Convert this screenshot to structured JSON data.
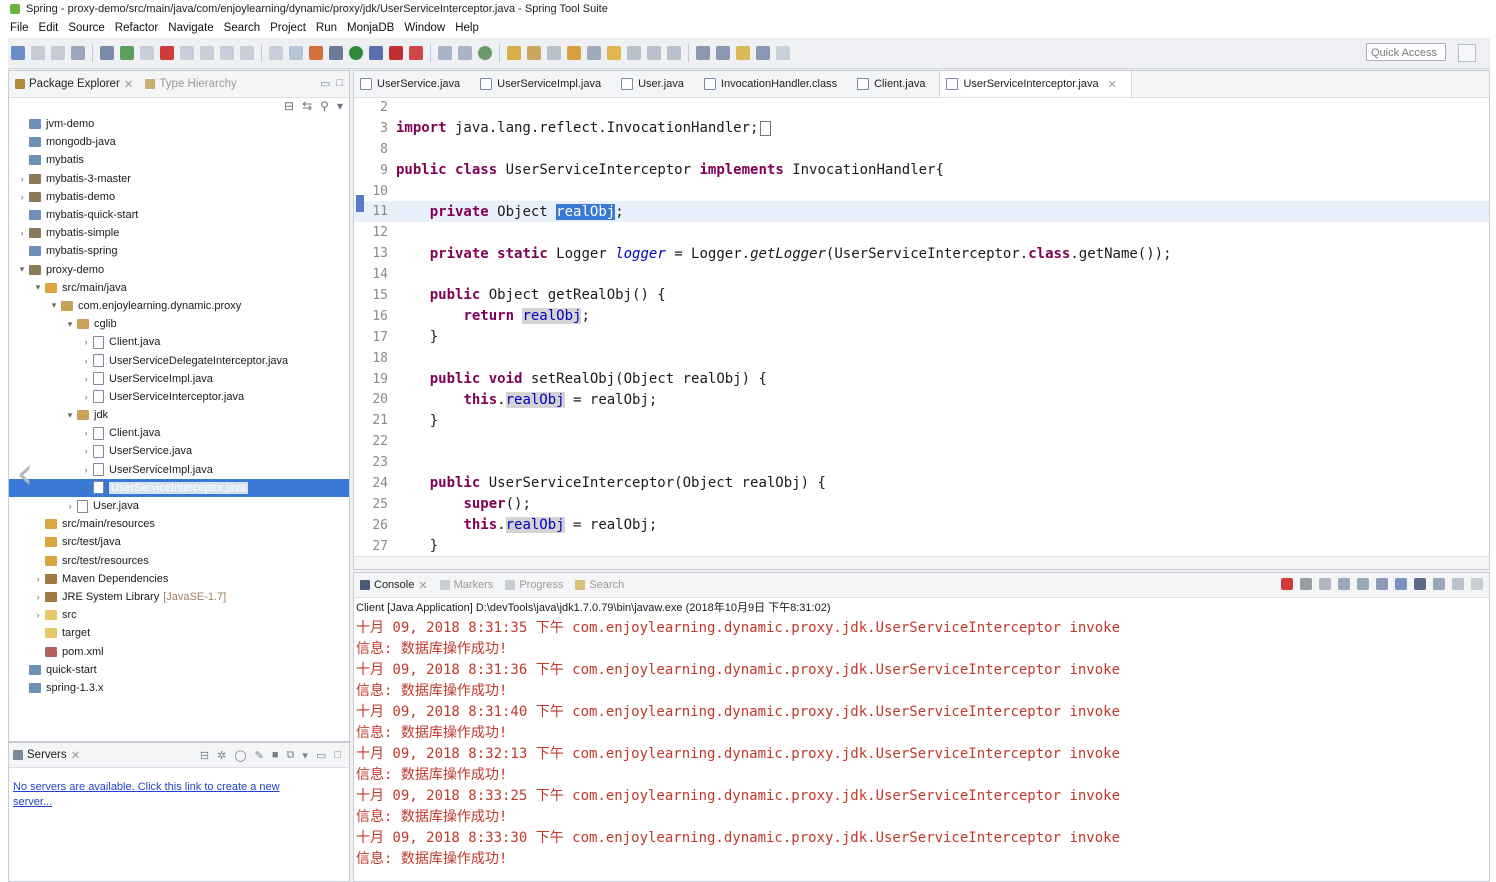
{
  "window": {
    "title": "Spring - proxy-demo/src/main/java/com/enjoylearning/dynamic/proxy/jdk/UserServiceInterceptor.java - Spring Tool Suite"
  },
  "menu": [
    "File",
    "Edit",
    "Source",
    "Refactor",
    "Navigate",
    "Search",
    "Project",
    "Run",
    "MonjaDB",
    "Window",
    "Help"
  ],
  "toolbar": {
    "quick_access": "Quick Access"
  },
  "explorer": {
    "tab_label": "Package Explorer",
    "tab2_label": "Type Hierarchy",
    "tree": [
      {
        "label": "jvm-demo",
        "arrow": "",
        "icon": "project",
        "indent": 0
      },
      {
        "label": "mongodb-java",
        "arrow": "",
        "icon": "project",
        "indent": 0
      },
      {
        "label": "mybatis",
        "arrow": "",
        "icon": "project",
        "indent": 0
      },
      {
        "label": "mybatis-3-master",
        "arrow": ">",
        "icon": "maven",
        "indent": 0
      },
      {
        "label": "mybatis-demo",
        "arrow": ">",
        "icon": "maven",
        "indent": 0
      },
      {
        "label": "mybatis-quick-start",
        "arrow": "",
        "icon": "project",
        "indent": 0
      },
      {
        "label": "mybatis-simple",
        "arrow": ">",
        "icon": "maven",
        "indent": 0
      },
      {
        "label": "mybatis-spring",
        "arrow": "",
        "icon": "project",
        "indent": 0
      },
      {
        "label": "proxy-demo",
        "arrow": "v",
        "icon": "maven",
        "indent": 0
      },
      {
        "label": "src/main/java",
        "arrow": "v",
        "icon": "srcf",
        "indent": 1
      },
      {
        "label": "com.enjoylearning.dynamic.proxy",
        "arrow": "v",
        "icon": "pkg",
        "indent": 2
      },
      {
        "label": "cglib",
        "arrow": "v",
        "icon": "pkg",
        "indent": 3
      },
      {
        "label": "Client.java",
        "arrow": ">",
        "icon": "java",
        "indent": 4
      },
      {
        "label": "UserServiceDelegateInterceptor.java",
        "arrow": ">",
        "icon": "java",
        "indent": 4
      },
      {
        "label": "UserServiceImpl.java",
        "arrow": ">",
        "icon": "java",
        "indent": 4
      },
      {
        "label": "UserServiceInterceptor.java",
        "arrow": ">",
        "icon": "java",
        "indent": 4
      },
      {
        "label": "jdk",
        "arrow": "v",
        "icon": "pkg",
        "indent": 3
      },
      {
        "label": "Client.java",
        "arrow": ">",
        "icon": "java",
        "indent": 4
      },
      {
        "label": "UserService.java",
        "arrow": ">",
        "icon": "java",
        "indent": 4
      },
      {
        "label": "UserServiceImpl.java",
        "arrow": ">",
        "icon": "java",
        "indent": 4
      },
      {
        "label": "UserServiceInterceptor.java",
        "arrow": ">",
        "icon": "java",
        "indent": 4,
        "selected": true
      },
      {
        "label": "User.java",
        "arrow": ">",
        "icon": "java",
        "indent": 3
      },
      {
        "label": "src/main/resources",
        "arrow": "",
        "icon": "srcf",
        "indent": 1
      },
      {
        "label": "src/test/java",
        "arrow": "",
        "icon": "srcf",
        "indent": 1
      },
      {
        "label": "src/test/resources",
        "arrow": "",
        "icon": "srcf",
        "indent": 1
      },
      {
        "label": "Maven Dependencies",
        "arrow": ">",
        "icon": "lib",
        "indent": 1
      },
      {
        "label": "JRE System Library",
        "suffix": "[JavaSE-1.7]",
        "arrow": ">",
        "icon": "lib",
        "indent": 1
      },
      {
        "label": "src",
        "arrow": ">",
        "icon": "folder",
        "indent": 1
      },
      {
        "label": "target",
        "arrow": "",
        "icon": "folder",
        "indent": 1
      },
      {
        "label": "pom.xml",
        "arrow": "",
        "icon": "xml",
        "indent": 1
      },
      {
        "label": "quick-start",
        "arrow": "",
        "icon": "project",
        "indent": 0
      },
      {
        "label": "spring-1.3.x",
        "arrow": "",
        "icon": "project",
        "indent": 0
      }
    ]
  },
  "servers": {
    "tab_label": "Servers",
    "link": "No servers are available. Click this link to create a new server..."
  },
  "editor": {
    "tabs": [
      "UserService.java",
      "UserServiceImpl.java",
      "User.java",
      "InvocationHandler.class",
      "Client.java",
      "UserServiceInterceptor.java"
    ],
    "active_tab": 5,
    "line_numbers": [
      "2",
      "3",
      "8",
      "9",
      "10",
      "11",
      "12",
      "13",
      "14",
      "15",
      "16",
      "17",
      "18",
      "19",
      "20",
      "21",
      "22",
      "23",
      "24",
      "25",
      "26",
      "27"
    ],
    "code": {
      "l3_import": "import",
      "l3_rest": " java.lang.reflect.InvocationHandler;",
      "l9_public": "public",
      "l9_class": "class",
      "l9_name": " UserServiceInterceptor ",
      "l9_impl": "implements",
      "l9_rest": " InvocationHandler{",
      "l11_private": "private",
      "l11_type": " Object ",
      "l11_field": "realObj",
      "l11_semi": ";",
      "l13_private": "private",
      "l13_static": "static",
      "l13_type": " Logger ",
      "l13_field": "logger",
      "l13_eq": " = Logger.",
      "l13_method": "getLogger",
      "l13_arg": "(UserServiceInterceptor.",
      "l13_classkw": "class",
      "l13_rest": ".getName());",
      "l15_public": "public",
      "l15_rest": " Object getRealObj() {",
      "l16_return": "return",
      "l16_field": "realObj",
      "l16_semi": ";",
      "l17": "}",
      "l19_public": "public",
      "l19_void": "void",
      "l19_rest": " setRealObj(Object realObj) {",
      "l20_this": "this",
      "l20_dot": ".",
      "l20_field": "realObj",
      "l20_rest": " = realObj;",
      "l21": "}",
      "l24_public": "public",
      "l24_rest": " UserServiceInterceptor(Object realObj) {",
      "l25_super": "super",
      "l25_rest": "();",
      "l26_this": "this",
      "l26_dot": ".",
      "l26_field": "realObj",
      "l26_rest": " = realObj;",
      "l27": "}"
    }
  },
  "console": {
    "tabs": [
      "Console",
      "Markers",
      "Progress",
      "Search"
    ],
    "launch": "Client [Java Application] D:\\devTools\\java\\jdk1.7.0.79\\bin\\javaw.exe (2018年10月9日 下午8:31:02)",
    "lines": [
      "十月 09, 2018 8:31:35 下午 com.enjoylearning.dynamic.proxy.jdk.UserServiceInterceptor invoke",
      "信息: 数据库操作成功!",
      "十月 09, 2018 8:31:36 下午 com.enjoylearning.dynamic.proxy.jdk.UserServiceInterceptor invoke",
      "信息: 数据库操作成功!",
      "十月 09, 2018 8:31:40 下午 com.enjoylearning.dynamic.proxy.jdk.UserServiceInterceptor invoke",
      "信息: 数据库操作成功!",
      "十月 09, 2018 8:32:13 下午 com.enjoylearning.dynamic.proxy.jdk.UserServiceInterceptor invoke",
      "信息: 数据库操作成功!",
      "十月 09, 2018 8:33:25 下午 com.enjoylearning.dynamic.proxy.jdk.UserServiceInterceptor invoke",
      "信息: 数据库操作成功!",
      "十月 09, 2018 8:33:30 下午 com.enjoylearning.dynamic.proxy.jdk.UserServiceInterceptor invoke",
      "信息: 数据库操作成功!"
    ]
  },
  "colors": {
    "keyword": "#7f0055",
    "field": "#0000c0",
    "console_log": "#c0392b",
    "selection": "#3a78d6"
  }
}
